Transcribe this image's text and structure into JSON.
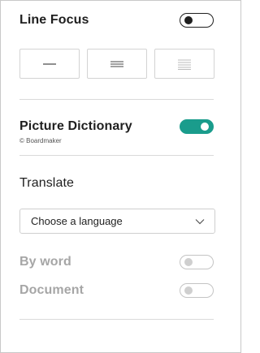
{
  "line_focus": {
    "label": "Line Focus",
    "toggle_state": "off",
    "buttons": [
      {
        "name": "one-line",
        "icon": "single-line-icon"
      },
      {
        "name": "three-lines",
        "icon": "three-lines-icon"
      },
      {
        "name": "five-lines",
        "icon": "five-lines-icon"
      }
    ]
  },
  "picture_dictionary": {
    "label": "Picture Dictionary",
    "credit": "© Boardmaker",
    "toggle_state": "on",
    "accent_color": "#1a9c8c"
  },
  "translate": {
    "heading": "Translate",
    "language_select": {
      "selected": "Choose a language",
      "icon": "chevron-down-icon"
    },
    "by_word": {
      "label": "By word",
      "toggle_state": "disabled"
    },
    "document": {
      "label": "Document",
      "toggle_state": "disabled"
    }
  }
}
